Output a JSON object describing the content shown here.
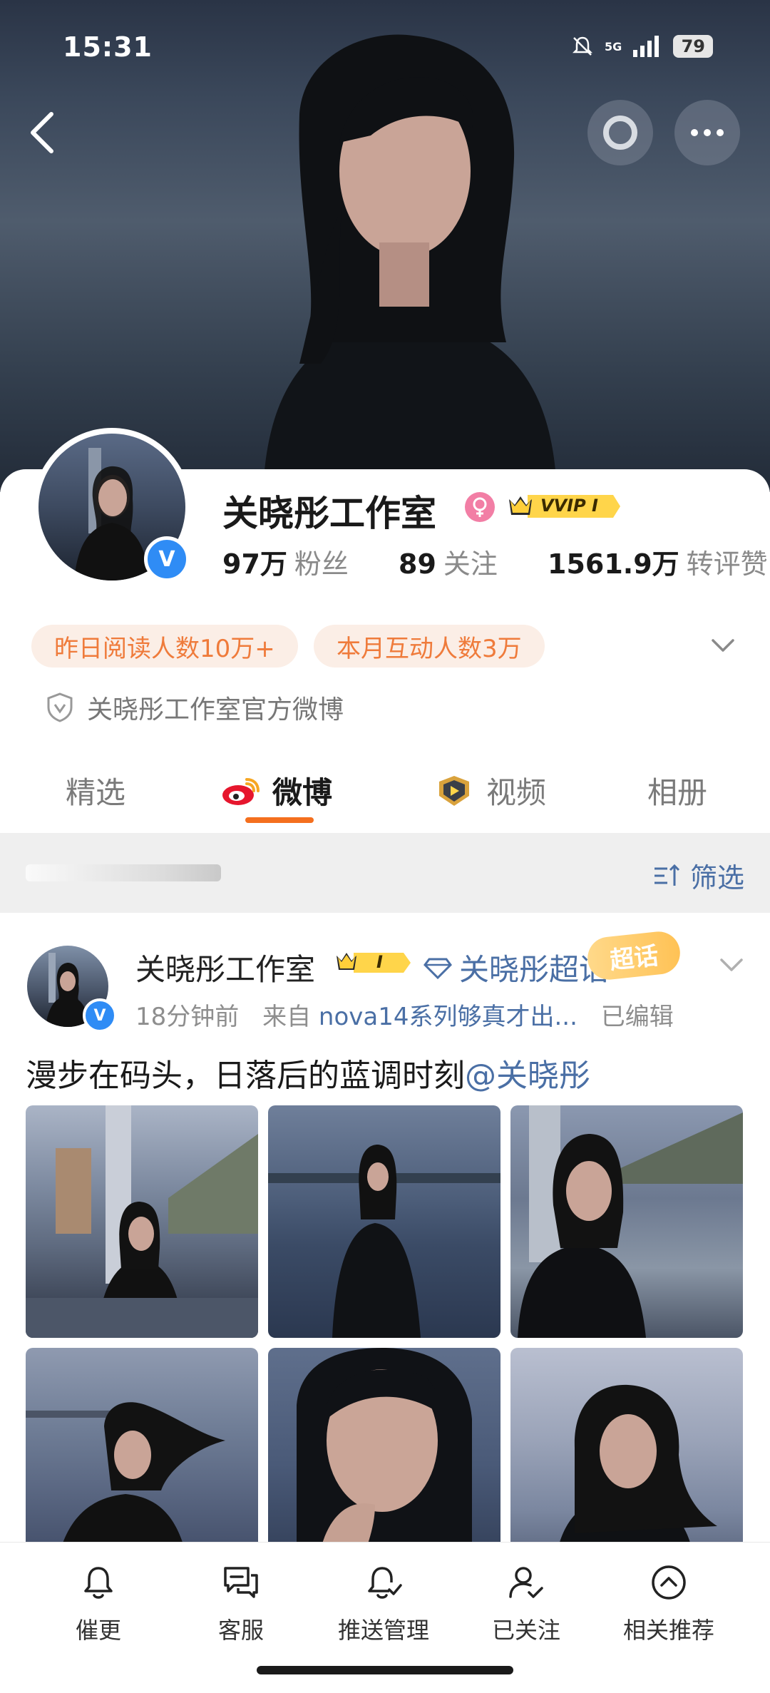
{
  "status_bar": {
    "time": "15:31",
    "network": "5G",
    "battery": "79"
  },
  "profile": {
    "name": "关晓彤工作室",
    "vip_badge": "VVIP I",
    "stats": [
      {
        "value": "97万",
        "label": "粉丝"
      },
      {
        "value": "89",
        "label": "关注"
      },
      {
        "value": "1561.9万",
        "label": "转评赞"
      }
    ],
    "pills": [
      "昨日阅读人数10万+",
      "本月互动人数3万"
    ],
    "official_desc": "关晓彤工作室官方微博"
  },
  "tabs": [
    {
      "label": "精选",
      "active": false
    },
    {
      "label": "微博",
      "active": true
    },
    {
      "label": "视频",
      "active": false
    },
    {
      "label": "相册",
      "active": false
    }
  ],
  "filter": {
    "label": "筛选"
  },
  "post": {
    "author": "关晓彤工作室",
    "rank_badge": "I",
    "super_topic": "关晓彤超话",
    "super_tag": "超话",
    "time": "18分钟前",
    "from_prefix": "来自",
    "device": "nova14系列够真才出...",
    "edited": "已编辑",
    "text": "漫步在码头，日落后的蓝调时刻",
    "mention": "@关晓彤"
  },
  "bottom_bar": [
    {
      "label": "催更",
      "icon": "bell-icon"
    },
    {
      "label": "客服",
      "icon": "chat-icon"
    },
    {
      "label": "推送管理",
      "icon": "bell-check-icon"
    },
    {
      "label": "已关注",
      "icon": "user-check-icon"
    },
    {
      "label": "相关推荐",
      "icon": "chevron-up-circle-icon"
    }
  ],
  "colors": {
    "accent": "#f46f1e",
    "link": "#4a6fa5",
    "verify": "#2f8cf5",
    "pill_text": "#ef7b3b",
    "pill_bg": "#fbeee6"
  }
}
